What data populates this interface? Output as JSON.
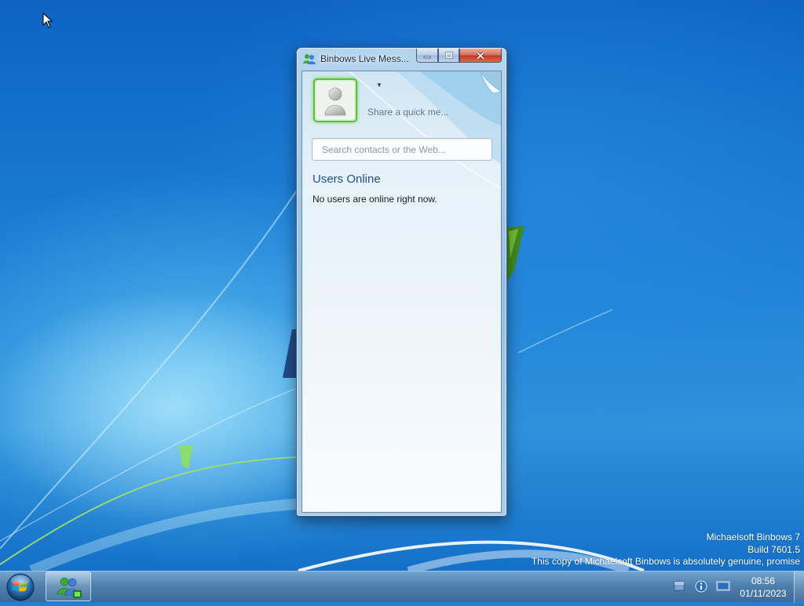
{
  "window": {
    "title": "Binbows Live Mess...",
    "quick_message": "Share a quick me...",
    "search_placeholder": "Search contacts or the Web...",
    "users_online_heading": "Users Online",
    "no_users_text": "No users are online right now."
  },
  "watermark": {
    "line1": "Michaelsoft Binbows 7",
    "line2": "Build 7601.5",
    "line3": "This copy of Michaelsoft Binbows is absolutely genuine, promise"
  },
  "taskbar": {
    "time": "08:56",
    "date": "01/11/2023",
    "pinned": [
      "messenger-icon"
    ],
    "tray_icons": [
      "flag-icon",
      "info-icon",
      "network-icon"
    ]
  },
  "colors": {
    "desktop": "#1f7fd3",
    "avatar_border": "#58c431",
    "close_button": "#c0391f",
    "heading": "#1f4f8f"
  }
}
